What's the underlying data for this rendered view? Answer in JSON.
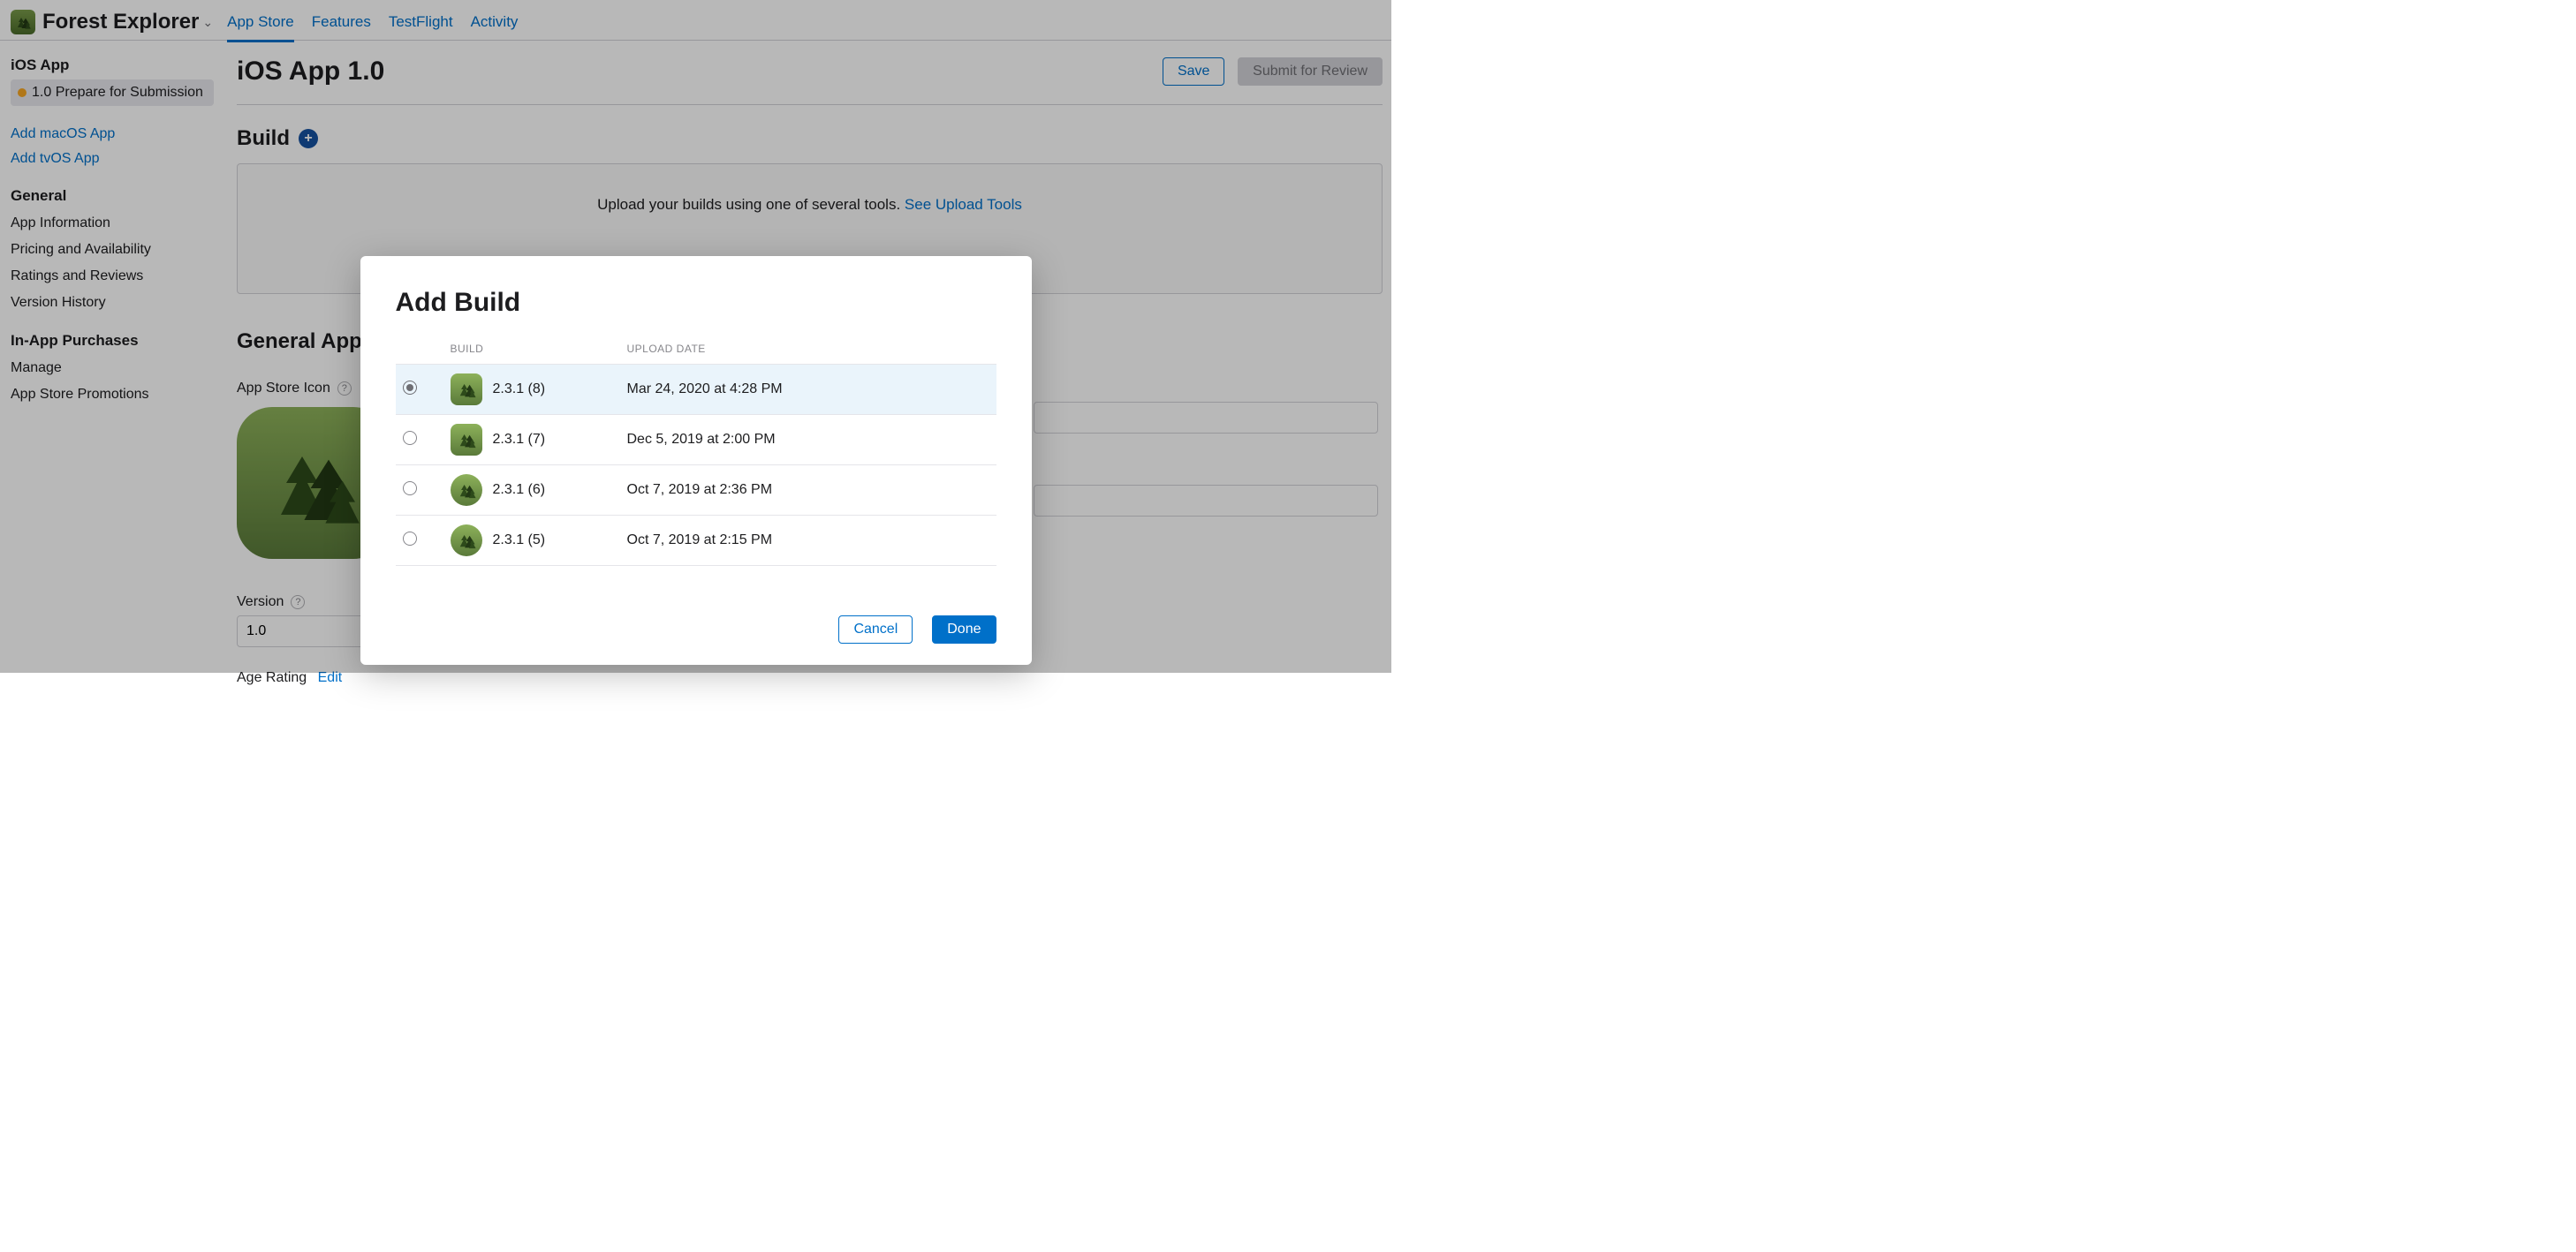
{
  "header": {
    "app_name": "Forest Explorer",
    "tabs": [
      "App Store",
      "Features",
      "TestFlight",
      "Activity"
    ],
    "active_tab": 0
  },
  "sidebar": {
    "platform_title": "iOS App",
    "version_item": "1.0 Prepare for Submission",
    "add_macos": "Add macOS App",
    "add_tvos": "Add tvOS App",
    "general_title": "General",
    "general_items": [
      "App Information",
      "Pricing and Availability",
      "Ratings and Reviews",
      "Version History"
    ],
    "iap_title": "In-App Purchases",
    "iap_items": [
      "Manage",
      "App Store Promotions"
    ]
  },
  "main": {
    "title": "iOS App 1.0",
    "save": "Save",
    "submit": "Submit for Review",
    "build_heading": "Build",
    "build_msg": "Upload your builds using one of several tools. ",
    "build_link": "See Upload Tools",
    "gen_info_heading": "General App Information",
    "icon_label": "App Store Icon",
    "version_label": "Version",
    "version_value": "1.0",
    "rating_label": "Age Rating",
    "rating_edit": "Edit"
  },
  "modal": {
    "title": "Add Build",
    "col_build": "BUILD",
    "col_date": "UPLOAD DATE",
    "rows": [
      {
        "build": "2.3.1 (8)",
        "date": "Mar 24, 2020 at 4:28 PM",
        "round": false,
        "selected": true
      },
      {
        "build": "2.3.1 (7)",
        "date": "Dec 5, 2019 at 2:00 PM",
        "round": false,
        "selected": false
      },
      {
        "build": "2.3.1 (6)",
        "date": "Oct 7, 2019 at 2:36 PM",
        "round": true,
        "selected": false
      },
      {
        "build": "2.3.1 (5)",
        "date": "Oct 7, 2019 at 2:15 PM",
        "round": true,
        "selected": false
      }
    ],
    "cancel": "Cancel",
    "done": "Done"
  }
}
